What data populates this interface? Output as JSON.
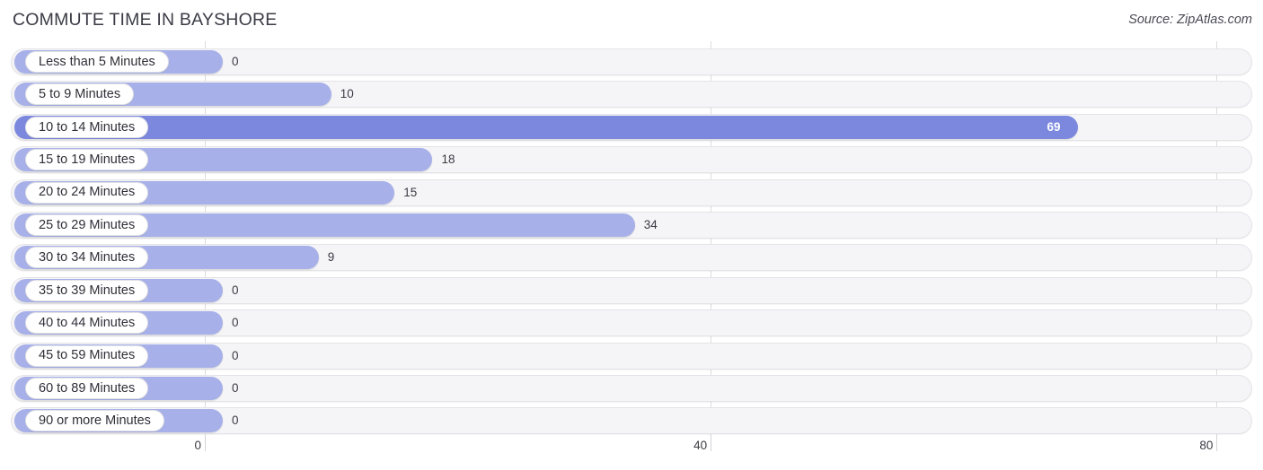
{
  "header": {
    "title": "COMMUTE TIME IN BAYSHORE",
    "source": "Source: ZipAtlas.com"
  },
  "colors": {
    "bar": "#a7b0e8",
    "bar_highlight": "#7b88de",
    "track": "#f5f5f7",
    "gridline": "#dcdcdc",
    "text": "#3a3a44"
  },
  "chart_data": {
    "type": "bar",
    "orientation": "horizontal",
    "title": "COMMUTE TIME IN BAYSHORE",
    "xlabel": "",
    "ylabel": "",
    "xlim": [
      0,
      80
    ],
    "grid": true,
    "legend": null,
    "xticks": [
      0,
      40,
      80
    ],
    "xtick_labels": [
      "0",
      "40",
      "80"
    ],
    "categories": [
      "Less than 5 Minutes",
      "5 to 9 Minutes",
      "10 to 14 Minutes",
      "15 to 19 Minutes",
      "20 to 24 Minutes",
      "25 to 29 Minutes",
      "30 to 34 Minutes",
      "35 to 39 Minutes",
      "40 to 44 Minutes",
      "45 to 59 Minutes",
      "60 to 89 Minutes",
      "90 or more Minutes"
    ],
    "values": [
      0,
      10,
      69,
      18,
      15,
      34,
      9,
      0,
      0,
      0,
      0,
      0
    ],
    "value_labels": [
      "0",
      "10",
      "69",
      "18",
      "15",
      "34",
      "9",
      "0",
      "0",
      "0",
      "0",
      "0"
    ],
    "highlight_index": 2
  }
}
